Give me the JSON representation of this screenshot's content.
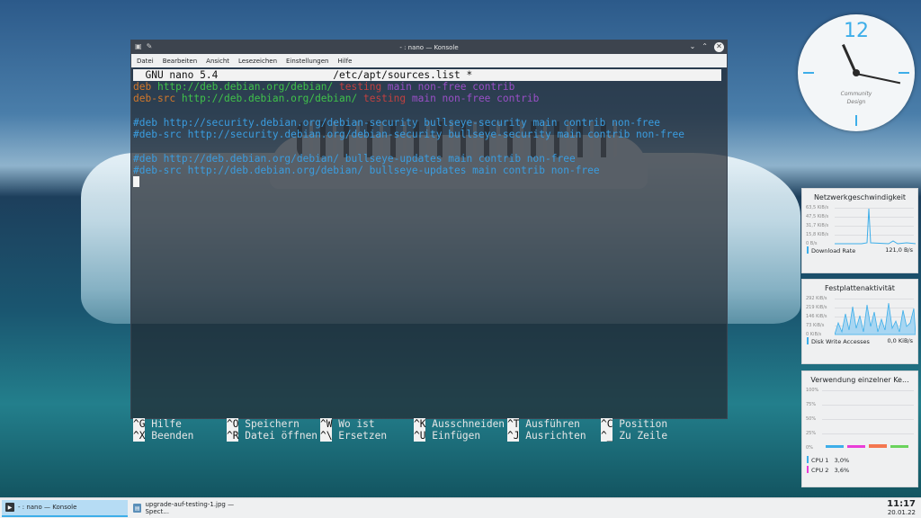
{
  "window": {
    "title": "- : nano — Konsole",
    "pin_icon": "pin-icon",
    "min_glyph": "⌄",
    "max_glyph": "⌃",
    "close_glyph": "✕"
  },
  "menu": [
    "Datei",
    "Bearbeiten",
    "Ansicht",
    "Lesezeichen",
    "Einstellungen",
    "Hilfe"
  ],
  "nano": {
    "version": "GNU nano 5.4",
    "filename": "/etc/apt/sources.list *",
    "lines": [
      [
        {
          "t": "deb ",
          "c": "orange"
        },
        {
          "t": "http://deb.debian.org/debian/ ",
          "c": "green"
        },
        {
          "t": "testing ",
          "c": "red"
        },
        {
          "t": "main non-free contrib",
          "c": "purple"
        }
      ],
      [
        {
          "t": "deb-src ",
          "c": "orange"
        },
        {
          "t": "http://deb.debian.org/debian/ ",
          "c": "green"
        },
        {
          "t": "testing ",
          "c": "red"
        },
        {
          "t": "main non-free contrib",
          "c": "purple"
        }
      ],
      [],
      [
        {
          "t": "#deb http://security.debian.org/debian-security bullseye-security main contrib non-free",
          "c": "blue"
        }
      ],
      [
        {
          "t": "#deb-src http://security.debian.org/debian-security bullseye-security main contrib non-free",
          "c": "blue"
        }
      ],
      [],
      [
        {
          "t": "#deb http://deb.debian.org/debian/ bullseye-updates main contrib non-free",
          "c": "blue"
        }
      ],
      [
        {
          "t": "#deb-src http://deb.debian.org/debian/ bullseye-updates main contrib non-free",
          "c": "blue"
        }
      ]
    ],
    "shortcuts_row1": [
      {
        "k": "^G",
        "l": "Hilfe"
      },
      {
        "k": "^O",
        "l": "Speichern"
      },
      {
        "k": "^W",
        "l": "Wo ist"
      },
      {
        "k": "^K",
        "l": "Ausschneiden"
      },
      {
        "k": "^T",
        "l": "Ausführen"
      },
      {
        "k": "^C",
        "l": "Position"
      }
    ],
    "shortcuts_row2": [
      {
        "k": "^X",
        "l": "Beenden"
      },
      {
        "k": "^R",
        "l": "Datei öffnen"
      },
      {
        "k": "^\\",
        "l": "Ersetzen"
      },
      {
        "k": "^U",
        "l": "Einfügen"
      },
      {
        "k": "^J",
        "l": "Ausrichten"
      },
      {
        "k": "^_",
        "l": "Zu Zeile"
      }
    ]
  },
  "clock_widget": {
    "twelve": "12",
    "brand_line1": "Community",
    "brand_line2": "Design",
    "accent": "#3daee9"
  },
  "widgets": {
    "network": {
      "title": "Netzwerkgeschwindigkeit",
      "axis": [
        "63,5 KiB/s",
        "47,5 KiB/s",
        "31,7 KiB/s",
        "15,8 KiB/s",
        "0 B/s"
      ],
      "legend_label": "Download Rate",
      "legend_value": "121,0 B/s"
    },
    "disk": {
      "title": "Festplattenaktivität",
      "axis": [
        "292 KiB/s",
        "219 KiB/s",
        "146 KiB/s",
        "73 KiB/s",
        "0 KiB/s"
      ],
      "legend_label": "Disk Write Accesses",
      "legend_value": "0,0 KiB/s"
    },
    "cpu": {
      "title": "Verwendung einzelner Ke...",
      "axis": [
        "100%",
        "75%",
        "50%",
        "25%",
        "0%"
      ],
      "cores": [
        {
          "label": "CPU 1",
          "value": "3,0%",
          "color": "#3daee9"
        },
        {
          "label": "CPU 2",
          "value": "3,6%",
          "color": "#e93dd8"
        }
      ]
    }
  },
  "taskbar": {
    "tasks": [
      {
        "label": "- : nano — Konsole",
        "active": true,
        "icon": "terminal-icon"
      },
      {
        "label": "upgrade-auf-testing-1.jpg — Spect...",
        "active": false,
        "icon": "image-icon"
      }
    ],
    "time": "11:17",
    "date": "20.01.22"
  }
}
